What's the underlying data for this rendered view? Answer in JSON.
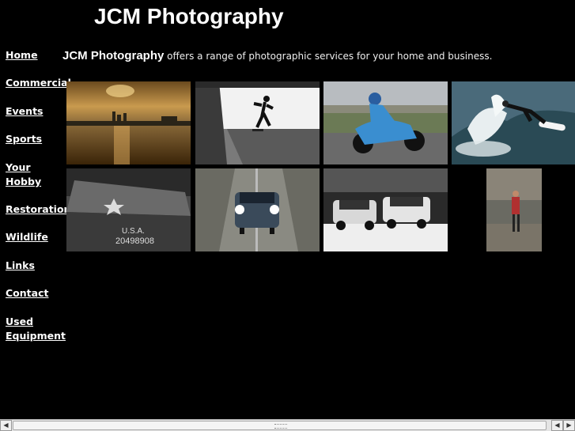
{
  "header": {
    "title": "JCM Photography"
  },
  "nav": {
    "items": [
      {
        "id": "home",
        "label": "Home"
      },
      {
        "id": "commercial",
        "label": "Commercial"
      },
      {
        "id": "events",
        "label": "Events"
      },
      {
        "id": "sports",
        "label": "Sports"
      },
      {
        "id": "your-hobby",
        "label": "Your Hobby"
      },
      {
        "id": "restoration",
        "label": "Restoration"
      },
      {
        "id": "wildlife",
        "label": "Wildlife"
      },
      {
        "id": "links",
        "label": "Links"
      },
      {
        "id": "contact",
        "label": "Contact"
      },
      {
        "id": "used-equipment",
        "label": "Used Equipment"
      }
    ]
  },
  "intro": {
    "brand": "JCM Photography",
    "text": " offers a range of photographic services for your home and business."
  },
  "gallery": {
    "photos": [
      {
        "subject": "sunset-harbour"
      },
      {
        "subject": "skateboarder"
      },
      {
        "subject": "motorcycle-racer"
      },
      {
        "subject": "surfer"
      },
      {
        "subject": "military-vehicle",
        "text": [
          "U.S.A.",
          "20498908"
        ]
      },
      {
        "subject": "car-on-road"
      },
      {
        "subject": "two-minis"
      },
      {
        "subject": "person-in-sea"
      }
    ]
  },
  "colors": {
    "background": "#000000",
    "text": "#ffffff"
  }
}
